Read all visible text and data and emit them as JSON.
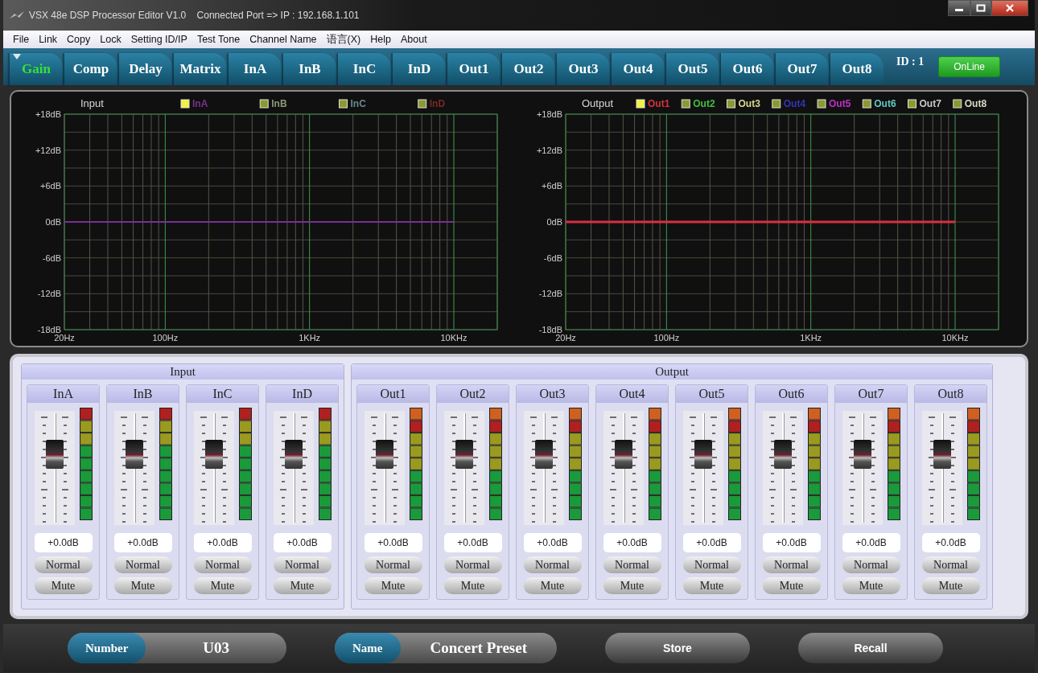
{
  "window": {
    "title": "VSX 48e DSP Processor Editor V1.0    Connected Port => IP : 192.168.1.101"
  },
  "menu": [
    "File",
    "Link",
    "Copy",
    "Lock",
    "Setting ID/IP",
    "Test Tone",
    "Channel Name",
    "语言(X)",
    "Help",
    "About"
  ],
  "tabs": [
    {
      "label": "Gain",
      "selected": true
    },
    {
      "label": "Comp",
      "selected": false
    },
    {
      "label": "Delay",
      "selected": false
    },
    {
      "label": "Matrix",
      "selected": false
    },
    {
      "label": "InA",
      "selected": false
    },
    {
      "label": "InB",
      "selected": false
    },
    {
      "label": "InC",
      "selected": false
    },
    {
      "label": "InD",
      "selected": false
    },
    {
      "label": "Out1",
      "selected": false
    },
    {
      "label": "Out2",
      "selected": false
    },
    {
      "label": "Out3",
      "selected": false
    },
    {
      "label": "Out4",
      "selected": false
    },
    {
      "label": "Out5",
      "selected": false
    },
    {
      "label": "Out6",
      "selected": false
    },
    {
      "label": "Out7",
      "selected": false
    },
    {
      "label": "Out8",
      "selected": false
    }
  ],
  "device_id": "ID : 1",
  "status": {
    "label": "OnLine",
    "online": true
  },
  "graphs": [
    {
      "legend": [
        {
          "label": "InA",
          "color": "#7a3090",
          "selected": true
        },
        {
          "label": "InB",
          "color": "#8a9a78",
          "selected": false
        },
        {
          "label": "InC",
          "color": "#6a8a88",
          "selected": false
        },
        {
          "label": "InD",
          "color": "#7a2828",
          "selected": false
        }
      ],
      "chart_data": {
        "type": "line",
        "title": "Input",
        "categories": [
          "20Hz",
          "100Hz",
          "1KHz",
          "10KHz"
        ],
        "ylim": [
          -18,
          18
        ],
        "grid": true,
        "yticks": [
          {
            "value": 18,
            "label": "+18dB"
          },
          {
            "value": 12,
            "label": "+12dB"
          },
          {
            "value": 6,
            "label": "+6dB"
          },
          {
            "value": 0,
            "label": "0dB"
          },
          {
            "value": -6,
            "label": "-6dB"
          },
          {
            "value": -12,
            "label": "-12dB"
          },
          {
            "value": -18,
            "label": "-18dB"
          }
        ],
        "series": [
          {
            "color": "#7a3090",
            "values": [
              0,
              0,
              0,
              0
            ]
          }
        ]
      }
    },
    {
      "legend": [
        {
          "label": "Out1",
          "color": "#d83040",
          "selected": true
        },
        {
          "label": "Out2",
          "color": "#40c040",
          "selected": false
        },
        {
          "label": "Out3",
          "color": "#d8d890",
          "selected": false
        },
        {
          "label": "Out4",
          "color": "#3434b8",
          "selected": false
        },
        {
          "label": "Out5",
          "color": "#c030c8",
          "selected": false
        },
        {
          "label": "Out6",
          "color": "#60c8c0",
          "selected": false
        },
        {
          "label": "Out7",
          "color": "#c8c8c8",
          "selected": false
        },
        {
          "label": "Out8",
          "color": "#d8d8c8",
          "selected": false
        }
      ],
      "chart_data": {
        "type": "line",
        "title": "Output",
        "categories": [
          "20Hz",
          "100Hz",
          "1KHz",
          "10KHz"
        ],
        "ylim": [
          -18,
          18
        ],
        "grid": true,
        "yticks": [
          {
            "value": 18,
            "label": "+18dB"
          },
          {
            "value": 12,
            "label": "+12dB"
          },
          {
            "value": 6,
            "label": "+6dB"
          },
          {
            "value": 0,
            "label": "0dB"
          },
          {
            "value": -6,
            "label": "-6dB"
          },
          {
            "value": -12,
            "label": "-12dB"
          },
          {
            "value": -18,
            "label": "-18dB"
          }
        ],
        "series": [
          {
            "color": "#d83040",
            "values": [
              0,
              0,
              0,
              0
            ]
          }
        ]
      }
    }
  ],
  "mixer": {
    "groups": [
      {
        "kind": "input",
        "title": "Input",
        "channels": [
          {
            "name": "InA",
            "level": 0.66,
            "value": "+0.0dB",
            "mode": "Normal",
            "mute": "Mute"
          },
          {
            "name": "InB",
            "level": 0.66,
            "value": "+0.0dB",
            "mode": "Normal",
            "mute": "Mute"
          },
          {
            "name": "InC",
            "level": 0.66,
            "value": "+0.0dB",
            "mode": "Normal",
            "mute": "Mute"
          },
          {
            "name": "InD",
            "level": 0.66,
            "value": "+0.0dB",
            "mode": "Normal",
            "mute": "Mute"
          }
        ]
      },
      {
        "kind": "output",
        "title": "Output",
        "channels": [
          {
            "name": "Out1",
            "level": 0.66,
            "value": "+0.0dB",
            "mode": "Normal",
            "mute": "Mute"
          },
          {
            "name": "Out2",
            "level": 0.66,
            "value": "+0.0dB",
            "mode": "Normal",
            "mute": "Mute"
          },
          {
            "name": "Out3",
            "level": 0.66,
            "value": "+0.0dB",
            "mode": "Normal",
            "mute": "Mute"
          },
          {
            "name": "Out4",
            "level": 0.66,
            "value": "+0.0dB",
            "mode": "Normal",
            "mute": "Mute"
          },
          {
            "name": "Out5",
            "level": 0.66,
            "value": "+0.0dB",
            "mode": "Normal",
            "mute": "Mute"
          },
          {
            "name": "Out6",
            "level": 0.66,
            "value": "+0.0dB",
            "mode": "Normal",
            "mute": "Mute"
          },
          {
            "name": "Out7",
            "level": 0.66,
            "value": "+0.0dB",
            "mode": "Normal",
            "mute": "Mute"
          },
          {
            "name": "Out8",
            "level": 0.66,
            "value": "+0.0dB",
            "mode": "Normal",
            "mute": "Mute"
          }
        ]
      }
    ]
  },
  "footer": {
    "number_label": "Number",
    "number": "U03",
    "name_label": "Name",
    "name": "Concert Preset",
    "buttons": [
      "Store",
      "Recall"
    ]
  }
}
